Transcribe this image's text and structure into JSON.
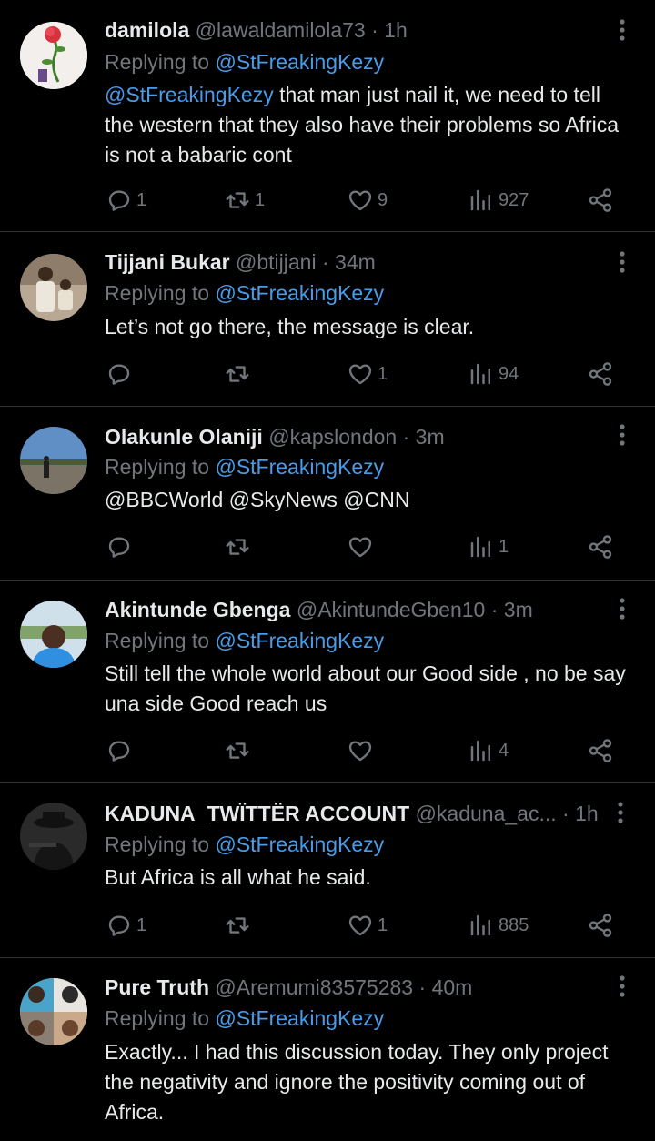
{
  "tweets": [
    {
      "name": "damilola",
      "handle": "@lawaldamilola73",
      "sep": "·",
      "time": "1h",
      "replying_prefix": "Replying to",
      "replying_to": "@StFreakingKezy",
      "mention": "@StFreakingKezy",
      "text": " that man just nail it, we need to tell the western that they also have their problems so Africa is not a babaric cont",
      "replies": "1",
      "retweets": "1",
      "likes": "9",
      "views": "927"
    },
    {
      "name": "Tijjani Bukar",
      "handle": "@btijjani",
      "sep": "·",
      "time": "34m",
      "replying_prefix": "Replying to",
      "replying_to": "@StFreakingKezy",
      "text": "Let’s not go there, the message is clear.",
      "replies": "",
      "retweets": "",
      "likes": "1",
      "views": "94"
    },
    {
      "name": "Olakunle Olaniji",
      "handle": "@kapslondon",
      "sep": "·",
      "time": "3m",
      "replying_prefix": "Replying to",
      "replying_to": "@StFreakingKezy",
      "text": "@BBCWorld @SkyNews @CNN",
      "replies": "",
      "retweets": "",
      "likes": "",
      "views": "1"
    },
    {
      "name": "Akintunde Gbenga",
      "handle": "@AkintundeGben10",
      "sep": "·",
      "time": "3m",
      "replying_prefix": "Replying to",
      "replying_to": "@StFreakingKezy",
      "text": "Still tell the whole world about our Good side , no be say una side Good reach us",
      "replies": "",
      "retweets": "",
      "likes": "",
      "views": "4"
    },
    {
      "name": "KADUNA_TWÏTTËR ACCOUNT",
      "handle": "@kaduna_ac...",
      "sep": "·",
      "time": "1h",
      "replying_prefix": "Replying to",
      "replying_to": "@StFreakingKezy",
      "text": "But Africa is all what he said.",
      "replies": "1",
      "retweets": "",
      "likes": "1",
      "views": "885"
    },
    {
      "name": "Pure Truth",
      "handle": "@Aremumi83575283",
      "sep": "·",
      "time": "40m",
      "replying_prefix": "Replying to",
      "replying_to": "@StFreakingKezy",
      "text": "Exactly... I had this discussion today. They only project the negativity and ignore the positivity coming out of Africa."
    }
  ],
  "icons": {
    "reply": "reply-icon",
    "retweet": "retweet-icon",
    "like": "heart-icon",
    "views": "views-icon",
    "share": "share-icon",
    "more": "more-icon"
  },
  "colors": {
    "background": "#000000",
    "text": "#e7e9ea",
    "muted": "#71767b",
    "link": "#4a9ce8",
    "divider": "#2f3336"
  }
}
